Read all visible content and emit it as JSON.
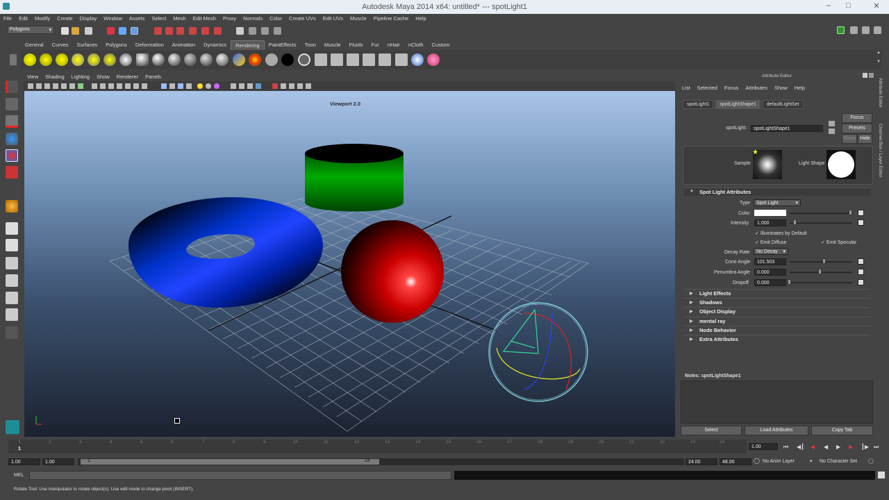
{
  "window": {
    "title": "Autodesk Maya 2014 x64: untitled*   ---   spotLight1"
  },
  "menubar": [
    "File",
    "Edit",
    "Modify",
    "Create",
    "Display",
    "Window",
    "Assets",
    "Select",
    "Mesh",
    "Edit Mesh",
    "Proxy",
    "Normals",
    "Color",
    "Create UVs",
    "Edit UVs",
    "Muscle",
    "Pipeline Cache",
    "Help"
  ],
  "mode_selector": "Polygons",
  "shelf_tabs": [
    "General",
    "Curves",
    "Surfaces",
    "Polygons",
    "Deformation",
    "Animation",
    "Dynamics",
    "Rendering",
    "PaintEffects",
    "Toon",
    "Muscle",
    "Fluids",
    "Fur",
    "nHair",
    "nCloth",
    "Custom"
  ],
  "active_shelf_tab": "Rendering",
  "viewport": {
    "menu": [
      "View",
      "Shading",
      "Lighting",
      "Show",
      "Renderer",
      "Panels"
    ],
    "renderer_label": "Viewport 2.0"
  },
  "attribute_editor": {
    "header": "Attribute Editor",
    "menu": [
      "List",
      "Selected",
      "Focus",
      "Attributes",
      "Show",
      "Help"
    ],
    "tabs": [
      "spotLight1",
      "spotLightShape1",
      "defaultLightSet"
    ],
    "active_tab": "spotLightShape1",
    "node_label": "spotLight:",
    "node_value": "spotLightShape1",
    "focus_btn": "Focus",
    "presets_btn": "Presets",
    "show_btn": "Show",
    "hide_btn": "Hide",
    "sample_label": "Sample",
    "light_shape_label": "Light Shape",
    "section_spot": "Spot Light Attributes",
    "type_label": "Type",
    "type_value": "Spot Light",
    "color_label": "Color",
    "intensity_label": "Intensity",
    "intensity_value": "1.000",
    "illum_default": "Illuminates by Default",
    "emit_diffuse": "Emit Diffuse",
    "emit_specular": "Emit Specular",
    "decay_label": "Decay Rate",
    "decay_value": "No Decay",
    "cone_label": "Cone Angle",
    "cone_value": "101.503",
    "penumbra_label": "Penumbra Angle",
    "penumbra_value": "0.000",
    "dropoff_label": "Dropoff",
    "dropoff_value": "0.000",
    "sections": [
      "Light Effects",
      "Shadows",
      "Object Display",
      "mental ray",
      "Node Behavior",
      "Extra Attributes"
    ],
    "notes_label": "Notes:  spotLightShape1",
    "bottom_buttons": [
      "Select",
      "Load Attributes",
      "Copy Tab"
    ]
  },
  "side_tabs": [
    "Attribute Editor",
    "Channel Box / Layer Editor"
  ],
  "timeline": {
    "ticks": [
      "1",
      "2",
      "3",
      "4",
      "5",
      "6",
      "7",
      "8",
      "9",
      "10",
      "11",
      "12",
      "13",
      "14",
      "15",
      "16",
      "17",
      "18",
      "19",
      "20",
      "21",
      "22",
      "23",
      "24"
    ],
    "current_frame_marker": "1",
    "current_time": "1.00"
  },
  "range": {
    "start": "1.00",
    "play_start": "1.00",
    "range_start": "1",
    "range_end": "24",
    "play_end": "24.00",
    "end": "48.00",
    "anim_layer": "No Anim Layer",
    "char_set": "No Character Set"
  },
  "mel_label": "MEL",
  "help_line": "Rotate Tool: Use manipulator to rotate object(s). Use edit mode to change pivot (INSERT)."
}
